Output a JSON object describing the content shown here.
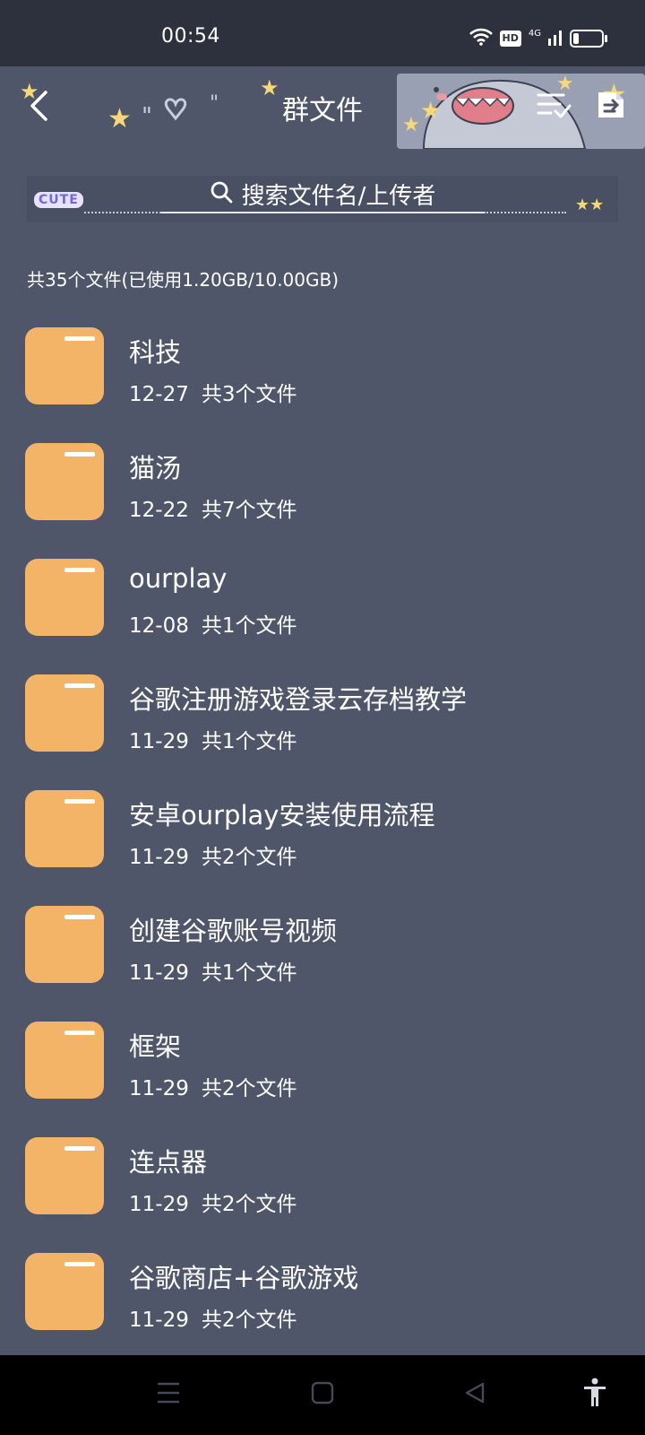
{
  "status_bar": {
    "time": "00:54",
    "hd_label": "HD",
    "network_label": "4G",
    "battery_level": 0.2
  },
  "header": {
    "title": "群文件",
    "back_icon": "chevron-left-icon",
    "sort_icon": "list-check-icon",
    "upload_icon": "file-upload-icon",
    "deco_tag": "CUTE"
  },
  "search": {
    "placeholder": "搜索文件名/上传者",
    "icon": "search-icon"
  },
  "summary": "共35个文件(已使用1.20GB/10.00GB)",
  "files": [
    {
      "name": "科技",
      "date": "12-27",
      "count": "共3个文件"
    },
    {
      "name": "猫汤",
      "date": "12-22",
      "count": "共7个文件"
    },
    {
      "name": "ourplay",
      "date": "12-08",
      "count": "共1个文件"
    },
    {
      "name": "谷歌注册游戏登录云存档教学",
      "date": "11-29",
      "count": "共1个文件"
    },
    {
      "name": "安卓ourplay安装使用流程",
      "date": "11-29",
      "count": "共2个文件"
    },
    {
      "name": "创建谷歌账号视频",
      "date": "11-29",
      "count": "共1个文件"
    },
    {
      "name": "框架",
      "date": "11-29",
      "count": "共2个文件"
    },
    {
      "name": "连点器",
      "date": "11-29",
      "count": "共2个文件"
    },
    {
      "name": "谷歌商店+谷歌游戏",
      "date": "11-29",
      "count": "共2个文件"
    }
  ],
  "colors": {
    "background": "#4f5669",
    "status_bar": "#2c313d",
    "folder": "#f4b467",
    "folder_tab": "#ffffff",
    "star": "#f6d77a"
  },
  "nav_bar": {
    "menu_icon": "menu-icon",
    "home_icon": "home-square-icon",
    "back_icon": "back-triangle-icon",
    "accessibility_icon": "accessibility-icon"
  }
}
